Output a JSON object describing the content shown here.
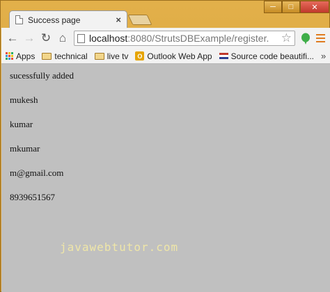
{
  "window": {
    "tab_title": "Success page",
    "tab_close": "×",
    "minimize": "─",
    "maximize": "□",
    "close": "✕"
  },
  "toolbar": {
    "back_icon": "←",
    "forward_icon": "→",
    "reload_icon": "↻",
    "home_icon": "⌂",
    "url_host": "localhost",
    "url_rest": ":8080/StrutsDBExample/register.",
    "star_icon": "☆"
  },
  "bookmarks": [
    {
      "label": "Apps",
      "icon": "apps-icon"
    },
    {
      "label": "technical",
      "icon": "folder-icon"
    },
    {
      "label": "live tv",
      "icon": "folder-icon"
    },
    {
      "label": "Outlook Web App",
      "icon": "outlook-icon"
    },
    {
      "label": "Source code beautifi...",
      "icon": "code-icon"
    }
  ],
  "bookmarks_more": "»",
  "content": {
    "lines": [
      "sucessfully added",
      "mukesh",
      "kumar",
      "mkumar",
      "m@gmail.com",
      "8939651567"
    ],
    "watermark": "javawebtutor.com"
  },
  "colors": {
    "page_bg": "#c0c0c0",
    "frame": "#d9a43f",
    "watermark": "#efe6a8"
  }
}
